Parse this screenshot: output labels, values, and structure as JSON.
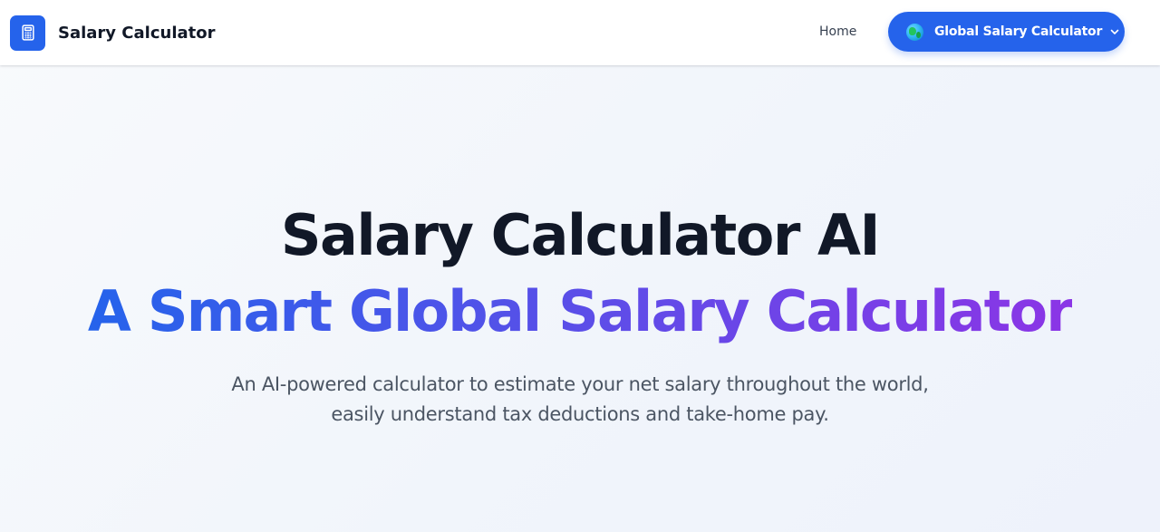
{
  "header": {
    "brand_name": "Salary Calculator",
    "brand_icon": "calculator-icon",
    "nav": {
      "home_label": "Home",
      "dropdown_label": "Global Salary Calculator",
      "dropdown_icon": "globe-icon",
      "dropdown_chevron": "chevron-down-icon"
    }
  },
  "hero": {
    "title": "Salary Calculator AI",
    "subtitle": "A Smart Global Salary Calculator",
    "description": "An AI-powered calculator to estimate your net salary throughout the world, easily understand tax deductions and take-home pay."
  },
  "colors": {
    "primary": "#2563eb",
    "gradient_start": "#2563eb",
    "gradient_end": "#8b35e6",
    "heading": "#111827",
    "body_text": "#4b5563"
  }
}
